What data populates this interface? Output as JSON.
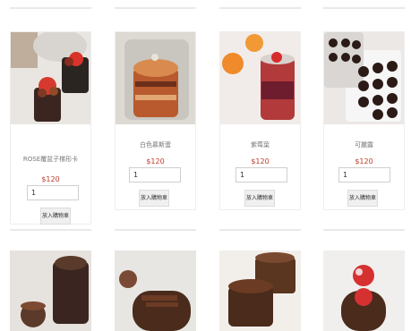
{
  "products": [
    {
      "name": "ROSE覆盆子梯形卡",
      "price": "$120",
      "qty": "1",
      "button": "放入購物車"
    },
    {
      "name": "白色慕斯蛋",
      "price": "$120",
      "qty": "1",
      "button": "放入購物車"
    },
    {
      "name": "紫莓葉",
      "price": "$120",
      "qty": "1",
      "button": "放入購物車"
    },
    {
      "name": "可麗露",
      "price": "$120",
      "qty": "1",
      "button": "放入購物車"
    }
  ],
  "colors": {
    "price": "#c0392b",
    "border": "#eeeeee",
    "button_bg": "#f0f0f0"
  }
}
